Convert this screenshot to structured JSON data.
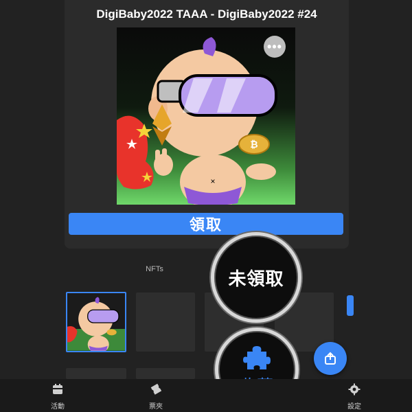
{
  "card": {
    "title": "DigiBaby2022 TAAA - DigiBaby2022 #24",
    "more_icon": "more-horizontal-icon",
    "claim_label": "領取"
  },
  "section": {
    "nfts_label": "NFTs"
  },
  "highlights": {
    "unclaimed_label": "未領取",
    "collect_label": "收藏",
    "collect_icon": "puzzle-icon"
  },
  "fab": {
    "icon": "share-icon"
  },
  "bottom_nav": {
    "items": [
      {
        "label": "活動",
        "icon": "calendar-icon"
      },
      {
        "label": "票夾",
        "icon": "ticket-icon"
      },
      {
        "label": "設定",
        "icon": "gear-icon"
      }
    ]
  },
  "colors": {
    "accent": "#3a86f5",
    "background": "#222222",
    "card": "#2b2b2b"
  }
}
